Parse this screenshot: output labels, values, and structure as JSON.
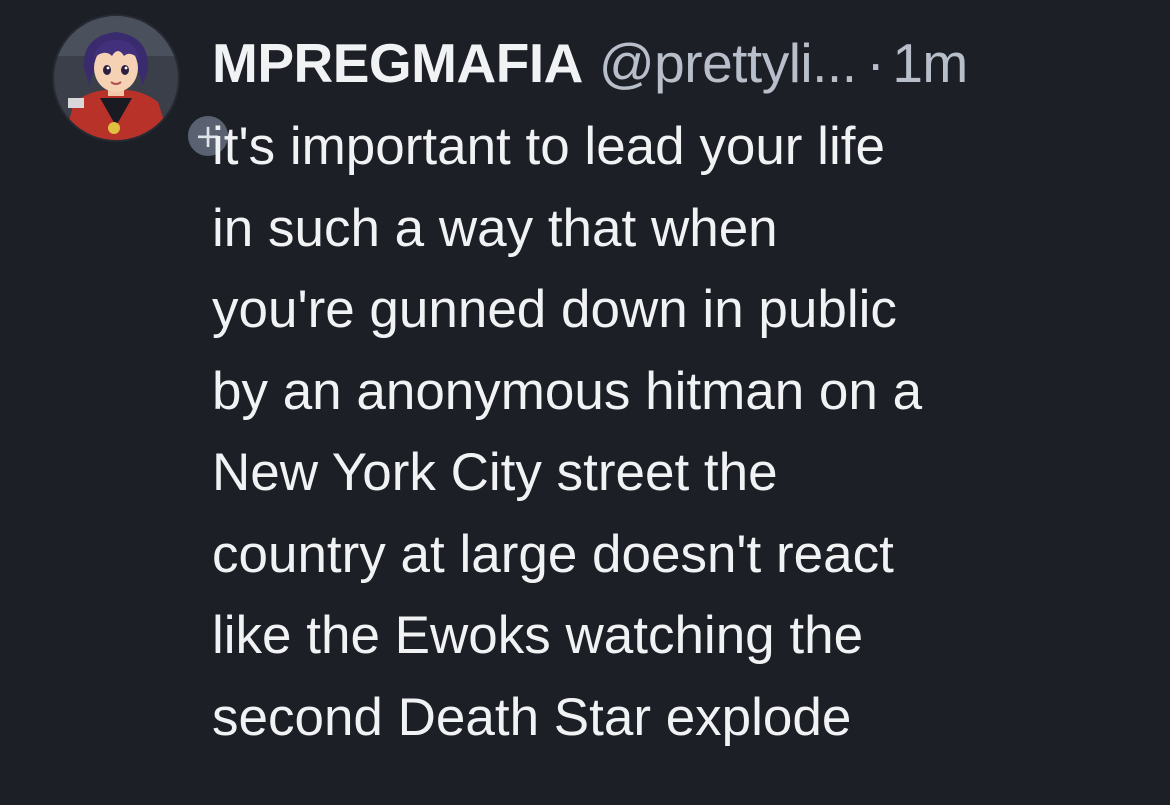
{
  "tweet": {
    "display_name": "MPREGMAFIA",
    "handle": "@prettyli...",
    "separator": "·",
    "timestamp": "1m",
    "follow_icon": "plus-icon",
    "follow_symbol": "+",
    "avatar_icon": "anime-character-avatar",
    "lines": [
      "it's important to lead your life",
      "in such a way that when",
      "you're gunned down in public",
      "by an anonymous hitman on a",
      "New York City street the",
      "country at large doesn't react",
      "like the Ewoks watching the",
      "second Death Star explode"
    ]
  },
  "colors": {
    "background": "#1c1f26",
    "text": "#f1f2f4",
    "muted": "#b9bfca",
    "follow_badge": "#5a6170"
  }
}
